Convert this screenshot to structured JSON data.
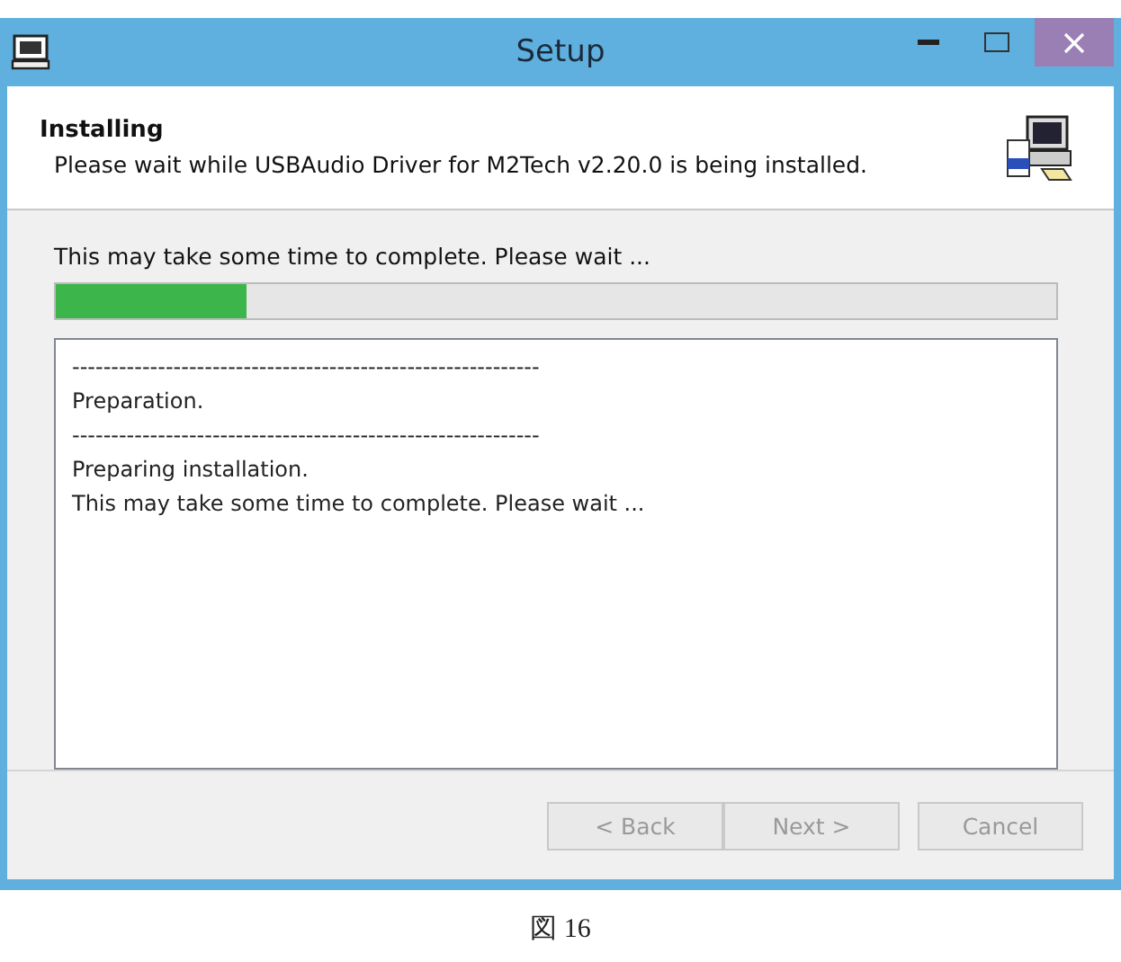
{
  "window": {
    "title": "Setup"
  },
  "header": {
    "title": "Installing",
    "subtitle": "Please wait while USBAudio Driver for M2Tech v2.20.0 is being installed."
  },
  "status_text": "This may take some time to complete. Please wait ...",
  "progress": {
    "level": 0.19
  },
  "log": [
    "------------------------------------------------------------",
    "Preparation.",
    "------------------------------------------------------------",
    "Preparing installation.",
    "This may take some time to complete. Please wait ..."
  ],
  "buttons": [
    {
      "label": "< Back",
      "disabled": true
    },
    {
      "label": "Next >",
      "disabled": true
    },
    {
      "label": "Cancel",
      "disabled": true
    }
  ],
  "caption": "図 16"
}
